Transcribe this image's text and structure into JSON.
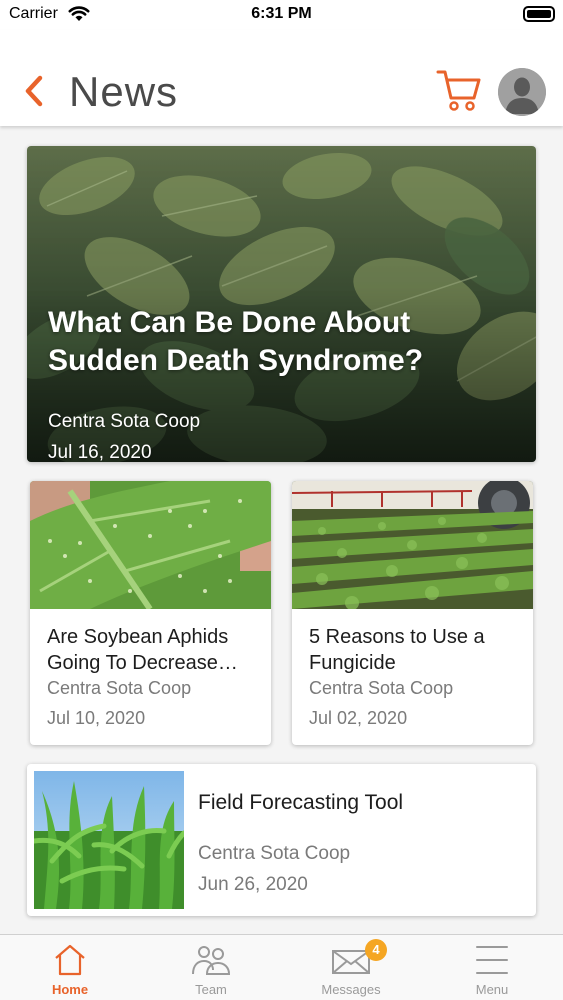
{
  "status_bar": {
    "carrier": "Carrier",
    "time": "6:31 PM"
  },
  "header": {
    "title": "News",
    "back_icon": "chevron-left-icon",
    "cart_icon": "cart-icon",
    "avatar_icon": "user-avatar-icon"
  },
  "colors": {
    "accent": "#e8632b",
    "badge": "#f5a623",
    "title_gray": "#4a4a4a",
    "meta_gray": "#7a7a7a"
  },
  "articles": {
    "featured": {
      "title": "What Can Be Done About Sudden Death Syndrome?",
      "source": "Centra Sota Coop",
      "date": "Jul 16, 2020"
    },
    "grid": [
      {
        "title": "Are Soybean Aphids Going To Decrease…",
        "source": "Centra Sota Coop",
        "date": "Jul 10, 2020"
      },
      {
        "title": "5 Reasons to Use a Fungicide",
        "source": "Centra Sota Coop",
        "date": "Jul 02, 2020"
      }
    ],
    "list": [
      {
        "title": "Field Forecasting Tool",
        "source": "Centra Sota Coop",
        "date": "Jun 26, 2020"
      }
    ]
  },
  "tab_bar": {
    "tabs": [
      {
        "label": "Home",
        "icon": "home-icon",
        "active": true
      },
      {
        "label": "Team",
        "icon": "team-icon",
        "active": false
      },
      {
        "label": "Messages",
        "icon": "envelope-icon",
        "active": false,
        "badge": "4"
      },
      {
        "label": "Menu",
        "icon": "hamburger-icon",
        "active": false
      }
    ]
  }
}
